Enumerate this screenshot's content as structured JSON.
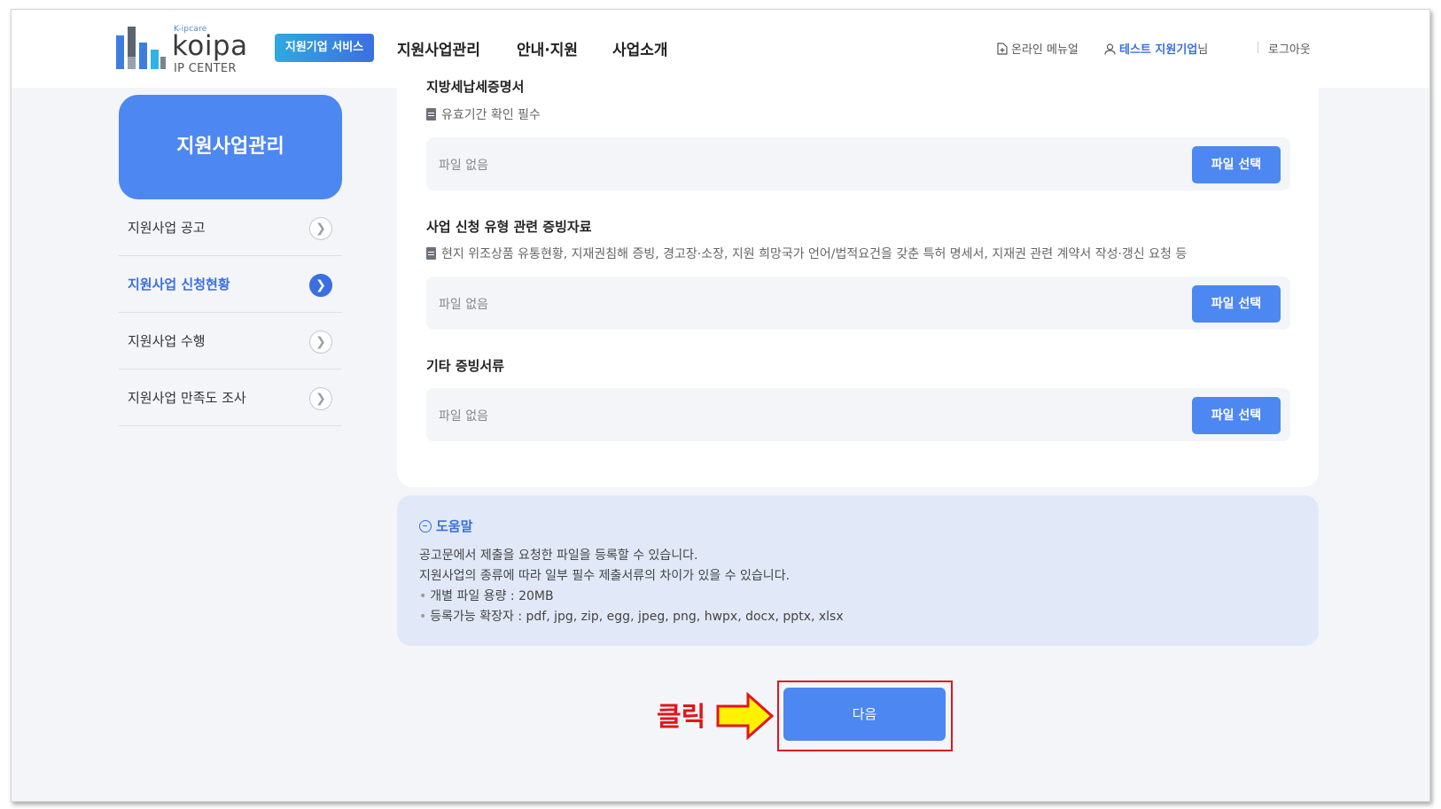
{
  "header": {
    "logo_small": "K-ipcare",
    "logo_word": "koipa",
    "logo_sub": "IP CENTER",
    "service_badge": "지원기업 서비스",
    "nav": [
      "지원사업관리",
      "안내·지원",
      "사업소개"
    ],
    "util": {
      "manual_icon": "document-plus-icon",
      "manual": "온라인 메뉴얼",
      "user_icon": "user-icon",
      "user_name": "테스트 지원기업",
      "user_suffix": "님",
      "logout": "로그아웃"
    }
  },
  "sidebar": {
    "title": "지원사업관리",
    "items": [
      {
        "label": "지원사업 공고",
        "active": false
      },
      {
        "label": "지원사업 신청현황",
        "active": true
      },
      {
        "label": "지원사업 수행",
        "active": false
      },
      {
        "label": "지원사업 만족도 조사",
        "active": false
      }
    ],
    "arrow_icon": "chevron-right-icon"
  },
  "uploads": [
    {
      "title": "지방세납세증명서",
      "desc_icon": "document-icon",
      "desc": "유효기간 확인 필수",
      "value": "파일 없음",
      "button": "파일 선택"
    },
    {
      "title": "사업 신청 유형 관련 증빙자료",
      "desc_icon": "document-icon",
      "desc": "현지 위조상품 유통현황, 지재권침해 증빙, 경고장·소장, 지원 희망국가 언어/법적요건을 갖춘 특허 명세서, 지재권 관련 계약서 작성·갱신 요청 등",
      "value": "파일 없음",
      "button": "파일 선택"
    },
    {
      "title": "기타 증빙서류",
      "value": "파일 없음",
      "button": "파일 선택"
    }
  ],
  "help": {
    "icon": "chat-bubble-icon",
    "title": "도움말",
    "lines": [
      "공고문에서 제출을 요청한 파일을 등록할 수 있습니다.",
      "지원사업의 종류에 따라 일부 필수 제출서류의 차이가 있을 수 있습니다."
    ],
    "bullets": [
      "개별 파일 용량 : 20MB",
      "등록가능 확장자 : pdf, jpg, zip, egg, jpeg, png, hwpx, docx, pptx, xlsx"
    ]
  },
  "next_button": "다음",
  "annotation": {
    "label": "클릭",
    "arrow_icon": "arrow-right-icon",
    "highlight_color": "#e3151b",
    "arrow_fill": "#fff200"
  },
  "colors": {
    "primary": "#4c87f2",
    "accent_text": "#3a6fe0",
    "help_bg": "#e1e9f8",
    "page_bg": "#f3f5f9"
  }
}
